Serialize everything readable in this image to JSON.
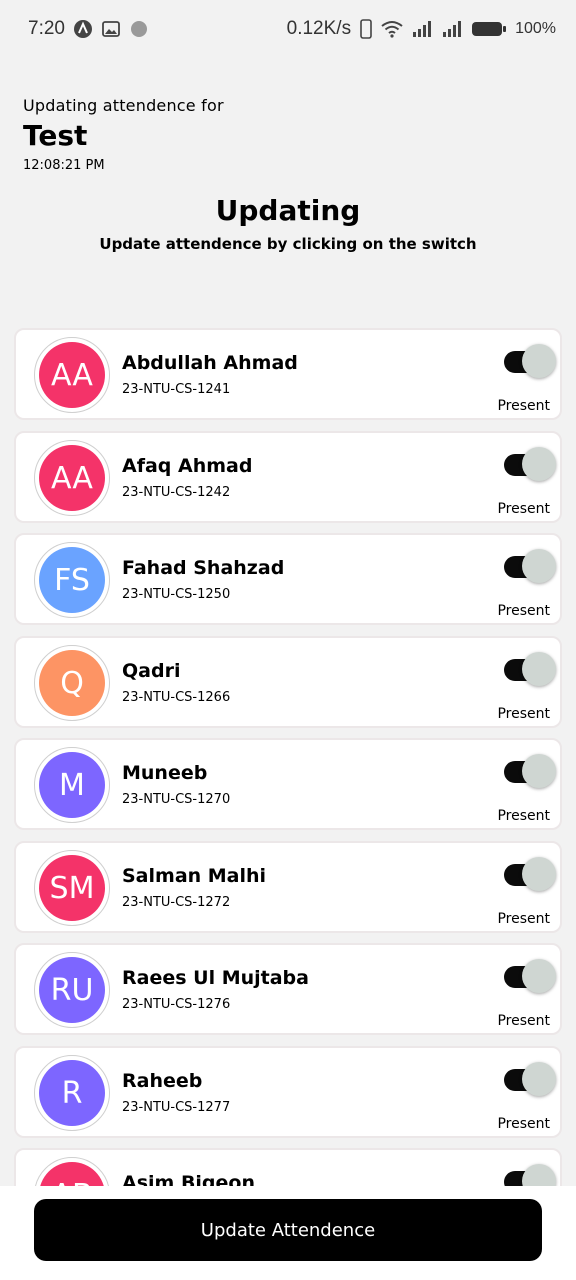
{
  "status_bar": {
    "time": "7:20",
    "network_speed": "0.12K/s",
    "battery": "100%"
  },
  "header": {
    "subtitle": "Updating attendence for",
    "title": "Test",
    "time": "12:08:21 PM"
  },
  "section": {
    "title": "Updating",
    "description": "Update attendence by clicking on the switch"
  },
  "students": [
    {
      "initials": "AA",
      "name": "Abdullah Ahmad",
      "roll": "23-NTU-CS-1241",
      "status": "Present",
      "color": "#f43369",
      "on": true
    },
    {
      "initials": "AA",
      "name": "Afaq Ahmad",
      "roll": "23-NTU-CS-1242",
      "status": "Present",
      "color": "#f43369",
      "on": true
    },
    {
      "initials": "FS",
      "name": "Fahad Shahzad",
      "roll": "23-NTU-CS-1250",
      "status": "Present",
      "color": "#6aa3ff",
      "on": true
    },
    {
      "initials": "Q",
      "name": "Qadri",
      "roll": "23-NTU-CS-1266",
      "status": "Present",
      "color": "#fd9464",
      "on": true
    },
    {
      "initials": "M",
      "name": "Muneeb",
      "roll": "23-NTU-CS-1270",
      "status": "Present",
      "color": "#7d66ff",
      "on": true
    },
    {
      "initials": "SM",
      "name": "Salman Malhi",
      "roll": "23-NTU-CS-1272",
      "status": "Present",
      "color": "#f43369",
      "on": true
    },
    {
      "initials": "RU",
      "name": "Raees Ul Mujtaba",
      "roll": "23-NTU-CS-1276",
      "status": "Present",
      "color": "#7d66ff",
      "on": true
    },
    {
      "initials": "R",
      "name": "Raheeb",
      "roll": "23-NTU-CS-1277",
      "status": "Present",
      "color": "#7d66ff",
      "on": true
    },
    {
      "initials": "AB",
      "name": "Asim Bigeon",
      "roll": "",
      "status": "",
      "color": "#f43369",
      "on": true
    }
  ],
  "action": {
    "label": "Update Attendence"
  }
}
